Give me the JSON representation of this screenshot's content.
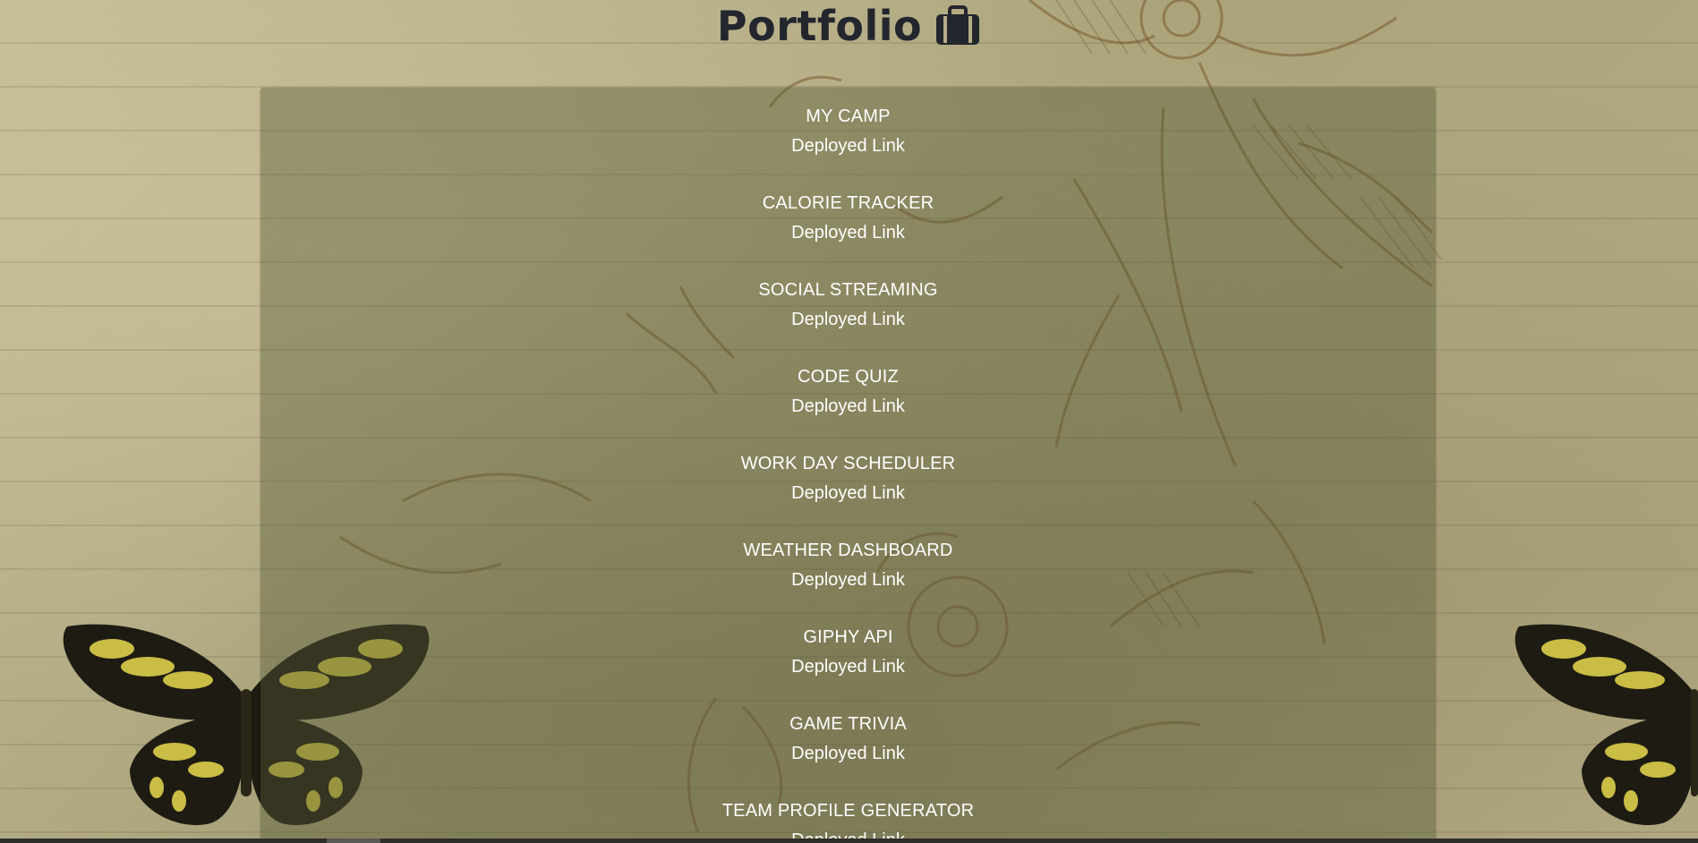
{
  "header": {
    "title": "Portfolio",
    "icon": "briefcase-icon"
  },
  "projects": [
    {
      "title": "MY CAMP",
      "link_label": "Deployed Link"
    },
    {
      "title": "CALORIE TRACKER",
      "link_label": "Deployed Link"
    },
    {
      "title": "SOCIAL STREAMING",
      "link_label": "Deployed Link"
    },
    {
      "title": "CODE QUIZ",
      "link_label": "Deployed Link"
    },
    {
      "title": "WORK DAY SCHEDULER",
      "link_label": "Deployed Link"
    },
    {
      "title": "WEATHER DASHBOARD",
      "link_label": "Deployed Link"
    },
    {
      "title": "GIPHY API",
      "link_label": "Deployed Link"
    },
    {
      "title": "GAME TRIVIA",
      "link_label": "Deployed Link"
    },
    {
      "title": "TEAM PROFILE GENERATOR",
      "link_label": "Deployed Link"
    }
  ],
  "colors": {
    "title_text": "#23262d",
    "project_text": "#ffffff",
    "panel_tint": "#555a37",
    "butterfly_yellow": "#c9bd45",
    "butterfly_dark": "#1e1b12"
  }
}
